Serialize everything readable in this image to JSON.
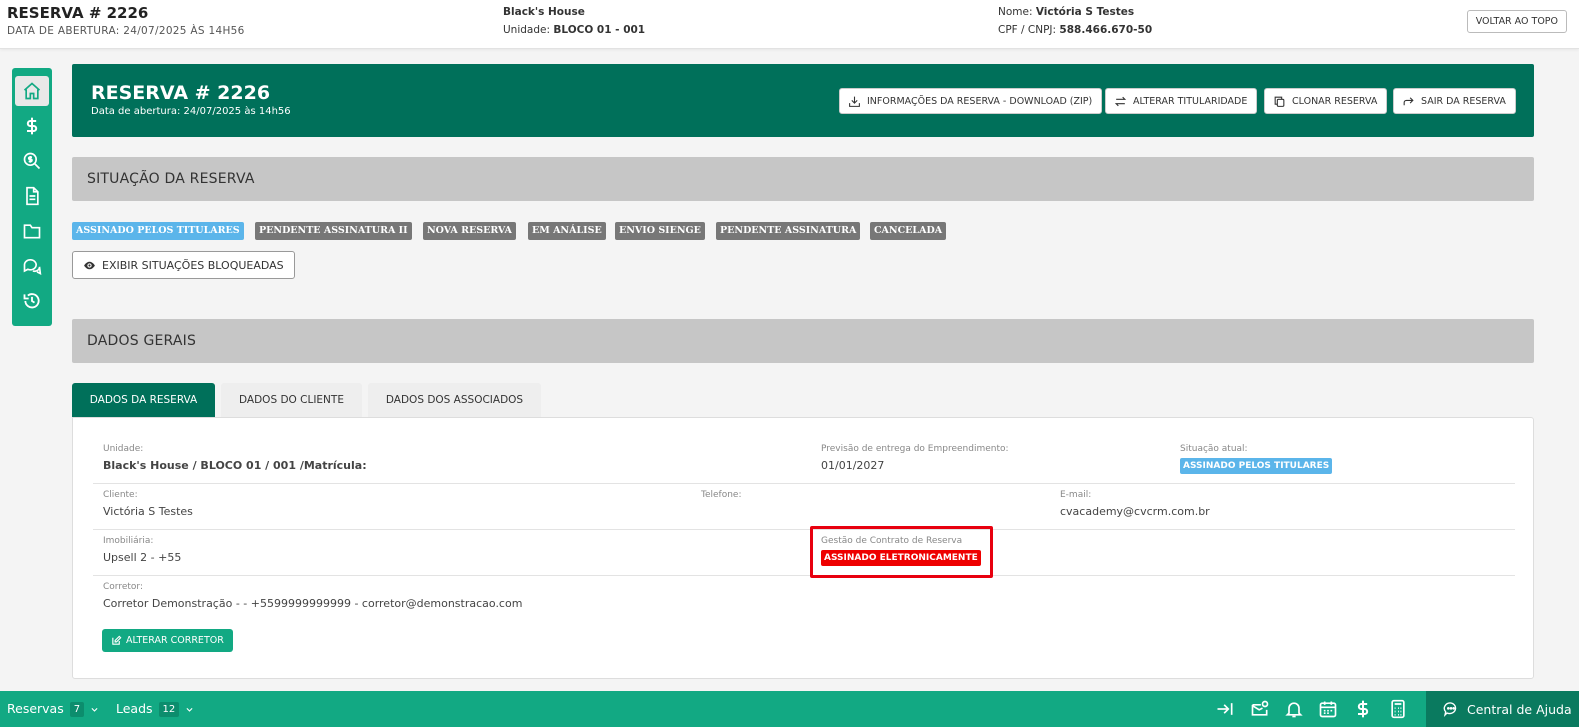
{
  "topbar": {
    "title": "RESERVA # 2226",
    "subtitle": "DATA DE ABERTURA: 24/07/2025 ÀS 14H56",
    "project": "Black's House",
    "unit_label": "Unidade:",
    "unit_value": "BLOCO 01 - 001",
    "name_label": "Nome:",
    "name_value": "Victória S Testes",
    "doc_label": "CPF / CNPJ:",
    "doc_value": "588.466.670-50",
    "back_top": "VOLTAR AO TOPO"
  },
  "sidebar": {
    "items": [
      {
        "icon": "home-icon",
        "active": true
      },
      {
        "icon": "dollar-icon"
      },
      {
        "icon": "search-dollar-icon"
      },
      {
        "icon": "document-icon"
      },
      {
        "icon": "folder-icon"
      },
      {
        "icon": "chat-icon"
      },
      {
        "icon": "history-icon"
      }
    ]
  },
  "header": {
    "title": "RESERVA # 2226",
    "subtitle": "Data de abertura: 24/07/2025 às 14h56",
    "buttons": {
      "download": "INFORMAÇÕES DA RESERVA - DOWNLOAD (ZIP)",
      "ownership": "ALTERAR TITULARIDADE",
      "clone": "CLONAR RESERVA",
      "exit": "SAIR DA RESERVA"
    }
  },
  "situacao": {
    "title": "SITUAÇÃO DA RESERVA",
    "badges": [
      "ASSINADO PELOS TITULARES",
      "PENDENTE ASSINATURA II",
      "NOVA RESERVA",
      "EM ANÁLISE",
      "ENVIO SIENGE",
      "PENDENTE ASSINATURA",
      "CANCELADA"
    ],
    "show_blocked": "EXIBIR SITUAÇÕES BLOQUEADAS"
  },
  "dados": {
    "title": "DADOS GERAIS",
    "tabs": [
      "DADOS DA RESERVA",
      "DADOS DO CLIENTE",
      "DADOS DOS ASSOCIADOS"
    ],
    "unidade_label": "Unidade:",
    "unidade_value": "Black's House / BLOCO 01 / 001 /Matrícula:",
    "previsao_label": "Previsão de entrega do Empreendimento:",
    "previsao_value": "01/01/2027",
    "situacao_label": "Situação atual:",
    "situacao_value": "ASSINADO PELOS TITULARES",
    "cliente_label": "Cliente:",
    "cliente_value": "Victória S Testes",
    "telefone_label": "Telefone:",
    "email_label": "E-mail:",
    "email_value": "cvacademy@cvcrm.com.br",
    "imobiliaria_label": "Imobiliária:",
    "imobiliaria_value": "Upsell 2 - +55",
    "gestao_label": "Gestão de Contrato de Reserva",
    "gestao_value": "ASSINADO ELETRONICAMENTE",
    "corretor_label": "Corretor:",
    "corretor_value": "Corretor Demonstração - - +5599999999999 - corretor@demonstracao.com",
    "alterar_corretor": "ALTERAR CORRETOR"
  },
  "bottombar": {
    "reservas_label": "Reservas",
    "reservas_count": "7",
    "leads_label": "Leads",
    "leads_count": "12",
    "help": "Central de Ajuda"
  },
  "colors": {
    "primary": "#00705a",
    "accent": "#12a983",
    "badge_blue": "#5bb5ea",
    "badge_gray": "#777777",
    "alert_red": "#e00000"
  }
}
